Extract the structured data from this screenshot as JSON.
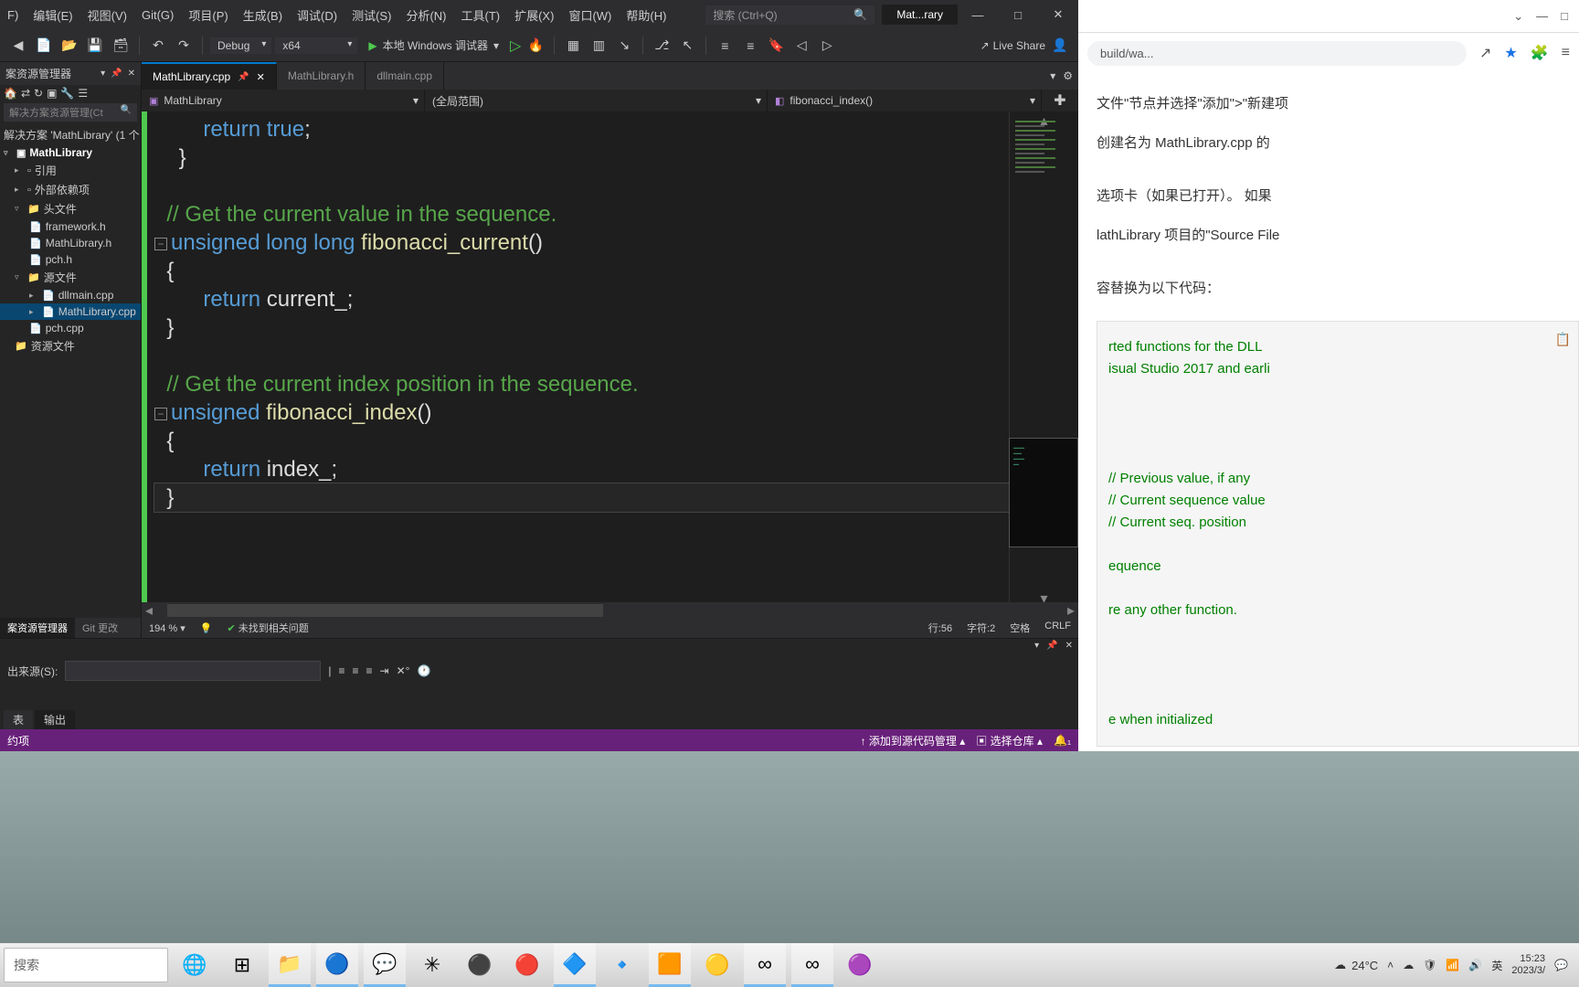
{
  "menu": {
    "file": "F)",
    "edit": "编辑(E)",
    "view": "视图(V)",
    "git": "Git(G)",
    "project": "项目(P)",
    "build": "生成(B)",
    "debug": "调试(D)",
    "test": "测试(S)",
    "analyze": "分析(N)",
    "tools": "工具(T)",
    "extensions": "扩展(X)",
    "window": "窗口(W)",
    "help": "帮助(H)"
  },
  "search_placeholder": "搜索 (Ctrl+Q)",
  "title_chip": "Mat...rary",
  "toolbar": {
    "config": "Debug",
    "platform": "x64",
    "debug_label": "本地 Windows 调试器",
    "liveshare": "Live Share"
  },
  "sln": {
    "header": "案资源管理器",
    "search": "解决方案资源管理(Ct",
    "solution": "解决方案 'MathLibrary' (1 个",
    "project": "MathLibrary",
    "refs": "引用",
    "ext_deps": "外部依赖项",
    "headers": "头文件",
    "h1": "framework.h",
    "h2": "MathLibrary.h",
    "h3": "pch.h",
    "sources": "源文件",
    "s1": "dllmain.cpp",
    "s2": "MathLibrary.cpp",
    "s3": "pch.cpp",
    "resources": "资源文件",
    "bottom_tab1": "案资源管理器",
    "bottom_tab2": "Git 更改"
  },
  "tabs": {
    "t1": "MathLibrary.cpp",
    "t2": "MathLibrary.h",
    "t3": "dllmain.cpp"
  },
  "nav": {
    "scope1": "MathLibrary",
    "scope2": "(全局范围)",
    "scope3": "fibonacci_index()"
  },
  "code": {
    "l1_a": "return",
    "l1_b": " true",
    "l1_c": ";",
    "l2": "}",
    "l4": "// Get the current value in the sequence.",
    "l5_a": "unsigned",
    "l5_b": " long",
    "l5_c": " long",
    "l5_d": " fibonacci_current",
    "l5_e": "()",
    "l6": "{",
    "l7_a": "return",
    "l7_b": " current_;",
    "l8": "}",
    "l10": "// Get the current index position in the sequence.",
    "l11_a": "unsigned",
    "l11_b": " fibonacci_index",
    "l11_c": "()",
    "l12": "{",
    "l13_a": "return",
    "l13_b": " index_;",
    "l14": "}"
  },
  "editor_status": {
    "zoom": "194 %",
    "issues": "未找到相关问题",
    "line": "行:56",
    "char": "字符:2",
    "spaces": "空格",
    "crlf": "CRLF"
  },
  "output": {
    "label": "出来源(S):",
    "tab1": "表",
    "tab2": "输出"
  },
  "vs_status": {
    "left": "约项",
    "src_ctrl": "添加到源代码管理",
    "repo": "选择仓库"
  },
  "browser": {
    "url": "build/wa...",
    "p1": "文件\"节点并选择\"添加\">\"新建项",
    "p2": "创建名为 MathLibrary.cpp 的",
    "p3": "选项卡（如果已打开）。 如果",
    "p4": "lathLibrary 项目的\"Source File",
    "p5": "容替换为以下代码：",
    "c1": "rted functions for the DLL",
    "c2": "isual Studio 2017 and earli",
    "c3": "// Previous value, if any",
    "c4": "// Current sequence value",
    "c5": "// Current seq. position",
    "c6": "equence",
    "c7": "re any other function.",
    "c8": "e when initialized"
  },
  "taskbar": {
    "search": "搜索",
    "weather": "24°C",
    "ime": "英",
    "time": "15:23",
    "date": "2023/3/"
  }
}
